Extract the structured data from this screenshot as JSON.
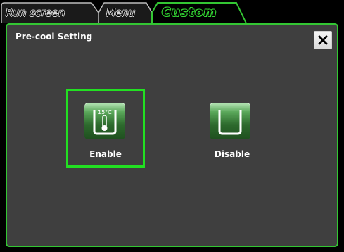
{
  "tabs": [
    {
      "label": "Run screen",
      "active": false
    },
    {
      "label": "Menu",
      "active": false
    },
    {
      "label": "Custom",
      "active": true
    }
  ],
  "panel": {
    "title": "Pre-cool Setting",
    "close_label": "×"
  },
  "options": [
    {
      "label": "Enable",
      "icon": "precool-thermometer-icon",
      "icon_text": "15°C",
      "selected": true
    },
    {
      "label": "Disable",
      "icon": "empty-chamber-icon",
      "selected": false
    }
  ],
  "colors": {
    "accent": "#33c633",
    "highlight": "#22e022",
    "panel_bg": "#3f3f3f",
    "screen_bg": "#000000"
  }
}
